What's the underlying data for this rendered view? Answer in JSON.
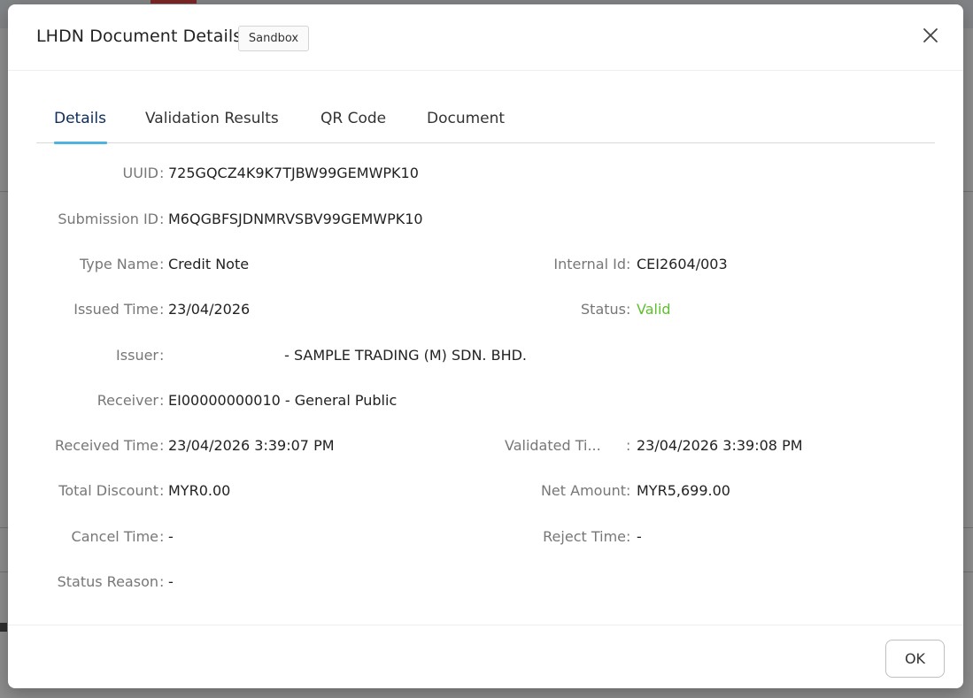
{
  "modal": {
    "title": "LHDN Document Details",
    "environment_badge": "Sandbox",
    "close_icon": "close-icon",
    "ok_label": "OK"
  },
  "tabs": [
    {
      "label": "Details",
      "active": true
    },
    {
      "label": "Validation Results",
      "active": false
    },
    {
      "label": "QR Code",
      "active": false
    },
    {
      "label": "Document",
      "active": false
    }
  ],
  "details": {
    "uuid": {
      "label": "UUID",
      "value": "725GQCZ4K9K7TJBW99GEMWPK10"
    },
    "submission_id": {
      "label": "Submission ID",
      "value": "M6QGBFSJDNMRVSBV99GEMWPK10"
    },
    "type_name": {
      "label": "Type Name",
      "value": "Credit Note"
    },
    "internal_id": {
      "label": "Internal Id",
      "value": "CEI2604/003"
    },
    "issued_time": {
      "label": "Issued Time",
      "value": "23/04/2026"
    },
    "status": {
      "label": "Status",
      "value": "Valid"
    },
    "issuer": {
      "label": "Issuer",
      "value": "- SAMPLE TRADING (M) SDN. BHD."
    },
    "receiver": {
      "label": "Receiver",
      "value": "EI00000000010 - General Public"
    },
    "received_time": {
      "label": "Received Time",
      "value": "23/04/2026 3:39:07 PM"
    },
    "validated_time": {
      "label": "Validated Ti...",
      "value": "23/04/2026 3:39:08 PM"
    },
    "total_discount": {
      "label": "Total Discount",
      "value": "MYR0.00"
    },
    "net_amount": {
      "label": "Net Amount",
      "value": "MYR5,699.00"
    },
    "cancel_time": {
      "label": "Cancel Time",
      "value": "-"
    },
    "reject_time": {
      "label": "Reject Time",
      "value": "-"
    },
    "status_reason": {
      "label": "Status Reason",
      "value": "-"
    }
  },
  "colors": {
    "valid_status": "#5fbf2c",
    "active_tab": "#0d2c5a",
    "tab_indicator": "#4fb3e0"
  }
}
